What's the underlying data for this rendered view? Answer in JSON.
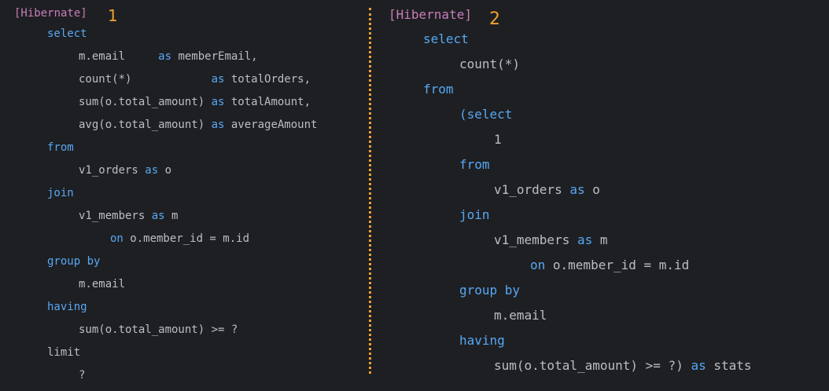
{
  "markers": {
    "left": "1",
    "right": "2"
  },
  "theme": {
    "background": "#1e1f22",
    "keyword_color": "#56a8f5",
    "tag_color": "#c77dbb",
    "text_color": "#bcbec4",
    "annotation_color": "#f0a030"
  },
  "left_query": {
    "lines": [
      [
        [
          "tag",
          "[Hibernate]"
        ]
      ],
      [
        [
          "kw",
          "select"
        ]
      ],
      [
        [
          "txt",
          "m.email     "
        ],
        [
          "kw",
          "as"
        ],
        [
          "txt",
          " memberEmail,"
        ]
      ],
      [
        [
          "txt",
          "count(*)            "
        ],
        [
          "kw",
          "as"
        ],
        [
          "txt",
          " totalOrders,"
        ]
      ],
      [
        [
          "txt",
          "sum(o.total_amount) "
        ],
        [
          "kw",
          "as"
        ],
        [
          "txt",
          " totalAmount,"
        ]
      ],
      [
        [
          "txt",
          "avg(o.total_amount) "
        ],
        [
          "kw",
          "as"
        ],
        [
          "txt",
          " averageAmount"
        ]
      ],
      [
        [
          "kw",
          "from"
        ]
      ],
      [
        [
          "txt",
          "v1_orders "
        ],
        [
          "kw",
          "as"
        ],
        [
          "txt",
          " o"
        ]
      ],
      [
        [
          "kw",
          "join"
        ]
      ],
      [
        [
          "txt",
          "v1_members "
        ],
        [
          "kw",
          "as"
        ],
        [
          "txt",
          " m"
        ]
      ],
      [
        [
          "kw",
          "on"
        ],
        [
          "txt",
          " o.member_id = m.id"
        ]
      ],
      [
        [
          "kw",
          "group by"
        ]
      ],
      [
        [
          "txt",
          "m.email"
        ]
      ],
      [
        [
          "kw",
          "having"
        ]
      ],
      [
        [
          "txt",
          "sum(o.total_amount) >= ?"
        ]
      ],
      [
        [
          "txt",
          "limit"
        ]
      ],
      [
        [
          "txt",
          "?"
        ]
      ]
    ]
  },
  "right_query": {
    "lines": [
      [
        [
          "tag",
          "[Hibernate]"
        ]
      ],
      [
        [
          "kw",
          "select"
        ]
      ],
      [
        [
          "txt",
          "count(*)"
        ]
      ],
      [
        [
          "kw",
          "from"
        ]
      ],
      [
        [
          "kw",
          "(select"
        ]
      ],
      [
        [
          "txt",
          "1"
        ]
      ],
      [
        [
          "kw",
          "from"
        ]
      ],
      [
        [
          "txt",
          "v1_orders "
        ],
        [
          "kw",
          "as"
        ],
        [
          "txt",
          " o"
        ]
      ],
      [
        [
          "kw",
          "join"
        ]
      ],
      [
        [
          "txt",
          "v1_members "
        ],
        [
          "kw",
          "as"
        ],
        [
          "txt",
          " m"
        ]
      ],
      [
        [
          "kw",
          "on"
        ],
        [
          "txt",
          " o.member_id = m.id"
        ]
      ],
      [
        [
          "kw",
          "group by"
        ]
      ],
      [
        [
          "txt",
          "m.email"
        ]
      ],
      [
        [
          "kw",
          "having"
        ]
      ],
      [
        [
          "txt",
          "sum(o.total_amount) >= ?) "
        ],
        [
          "kw",
          "as"
        ],
        [
          "txt",
          " stats"
        ]
      ]
    ]
  }
}
